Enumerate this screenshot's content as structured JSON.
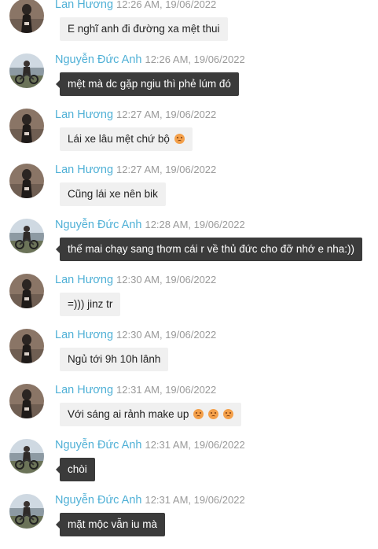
{
  "messages": [
    {
      "sender": "Lan Hương",
      "time": "12:26 AM, 19/06/2022",
      "text": "E nghĩ anh đi đường xa mệt thui",
      "style": "light",
      "avatar": "lan-avatar",
      "emoji_count": 0
    },
    {
      "sender": "Nguyễn Đức Anh",
      "time": "12:26 AM, 19/06/2022",
      "text": "mệt mà dc gặp ngiu thì phẻ lúm đó",
      "style": "dark",
      "avatar": "anh-avatar",
      "emoji_count": 0
    },
    {
      "sender": "Lan Hương",
      "time": "12:27 AM, 19/06/2022",
      "text": "Lái xe lâu mệt chứ bộ",
      "style": "light",
      "avatar": "lan-avatar",
      "emoji_count": 1
    },
    {
      "sender": "Lan Hương",
      "time": "12:27 AM, 19/06/2022",
      "text": "Cũng lái xe nên bik",
      "style": "light",
      "avatar": "lan-avatar",
      "emoji_count": 0
    },
    {
      "sender": "Nguyễn Đức Anh",
      "time": "12:28 AM, 19/06/2022",
      "text": "thế mai chạy sang thơm cái r về thủ đức cho đỡ nhớ e nha:))",
      "style": "dark",
      "avatar": "anh-avatar",
      "emoji_count": 0
    },
    {
      "sender": "Lan Hương",
      "time": "12:30 AM, 19/06/2022",
      "text": "=))) jinz tr",
      "style": "light",
      "avatar": "lan-avatar",
      "emoji_count": 0
    },
    {
      "sender": "Lan Hương",
      "time": "12:30 AM, 19/06/2022",
      "text": "Ngủ tới 9h 10h lânh",
      "style": "light",
      "avatar": "lan-avatar",
      "emoji_count": 0
    },
    {
      "sender": "Lan Hương",
      "time": "12:31 AM, 19/06/2022",
      "text": "Với sáng ai rảnh make up",
      "style": "light",
      "avatar": "lan-avatar",
      "emoji_count": 3
    },
    {
      "sender": "Nguyễn Đức Anh",
      "time": "12:31 AM, 19/06/2022",
      "text": "chòi",
      "style": "dark",
      "avatar": "anh-avatar",
      "emoji_count": 0
    },
    {
      "sender": "Nguyễn Đức Anh",
      "time": "12:31 AM, 19/06/2022",
      "text": "mặt mộc vẫn iu mà",
      "style": "dark",
      "avatar": "anh-avatar",
      "emoji_count": 0
    }
  ],
  "emoji": "sad-face-emoji",
  "colors": {
    "name": "#4fb0d6",
    "time": "#9a9a9a",
    "light_bubble": "#f0f0f0",
    "dark_bubble": "#3b3b3b"
  }
}
